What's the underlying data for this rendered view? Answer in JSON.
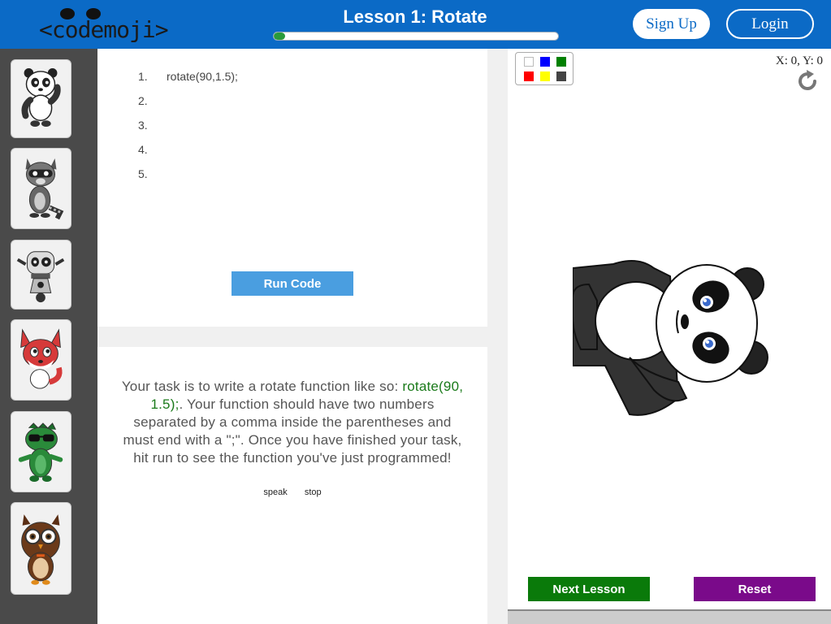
{
  "header": {
    "logo_text": "<codemoji>",
    "lesson_title": "Lesson 1: Rotate",
    "progress_fraction": 0.04,
    "signup_label": "Sign Up",
    "login_label": "Login"
  },
  "sidebar": {
    "characters": [
      "panda",
      "raccoon",
      "robot",
      "fox",
      "dinosaur",
      "owl"
    ]
  },
  "editor": {
    "line_numbers": [
      "1.",
      "2.",
      "3.",
      "4.",
      "5."
    ],
    "code_line_1": "rotate(90,1.5);",
    "run_label": "Run Code"
  },
  "task": {
    "text_before": "Your task is to write a rotate function like so: ",
    "code_example": "rotate(90, 1.5);",
    "text_after": ". Your function should have two numbers separated by a comma inside the parentheses and must end with a \";\". Once you have finished your task, hit run to see the function you've just programmed!",
    "speak_label": "speak",
    "stop_label": "stop"
  },
  "stage": {
    "coords_text": "X: 0, Y: 0",
    "palette_colors": [
      "#ffffff",
      "#0000ff",
      "#008000",
      "#ff0000",
      "#ffff00",
      "#444444"
    ],
    "next_label": "Next Lesson",
    "reset_label": "Reset"
  },
  "colors": {
    "header_blue": "#0b6ac6",
    "run_blue": "#4a9ee0",
    "next_green": "#0a7a0a",
    "reset_purple": "#7a0a8a",
    "code_green": "#1a7a1a"
  }
}
